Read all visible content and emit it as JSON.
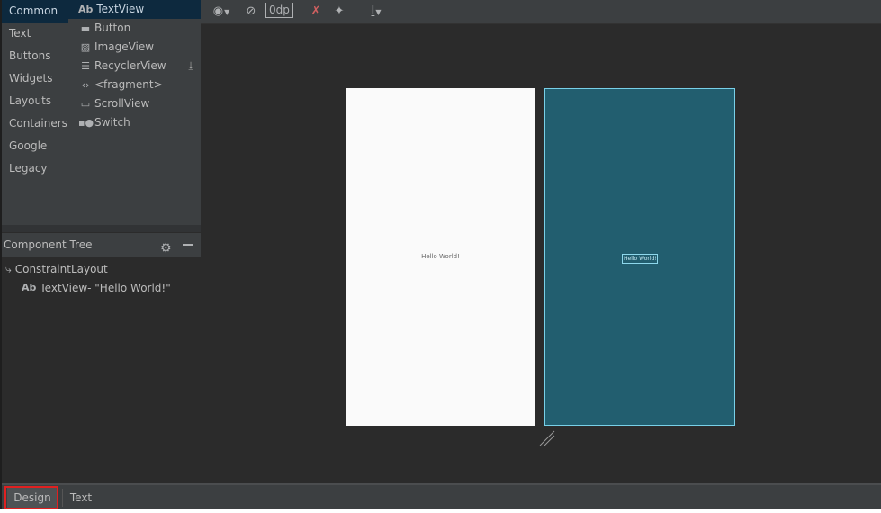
{
  "palette": {
    "categories": [
      {
        "label": "Common",
        "selected": true
      },
      {
        "label": "Text",
        "selected": false
      },
      {
        "label": "Buttons",
        "selected": false
      },
      {
        "label": "Widgets",
        "selected": false
      },
      {
        "label": "Layouts",
        "selected": false
      },
      {
        "label": "Containers",
        "selected": false
      },
      {
        "label": "Google",
        "selected": false
      },
      {
        "label": "Legacy",
        "selected": false
      }
    ],
    "widgets": [
      {
        "label": "TextView",
        "icon": "Ab",
        "icon_name": "textview-icon",
        "selected": true
      },
      {
        "label": "Button",
        "icon": "▬",
        "icon_name": "button-icon",
        "selected": false
      },
      {
        "label": "ImageView",
        "icon": "▨",
        "icon_name": "imageview-icon",
        "selected": false
      },
      {
        "label": "RecyclerView",
        "icon": "☰",
        "icon_name": "recyclerview-icon",
        "selected": false
      },
      {
        "label": "<fragment>",
        "icon": "‹›",
        "icon_name": "fragment-icon",
        "selected": false
      },
      {
        "label": "ScrollView",
        "icon": "▭",
        "icon_name": "scrollview-icon",
        "selected": false
      },
      {
        "label": "Switch",
        "icon": "▪●",
        "icon_name": "switch-icon",
        "selected": false
      }
    ],
    "download_icon": "⤓"
  },
  "component_tree": {
    "title": "Component Tree",
    "root": {
      "label": "ConstraintLayout",
      "icon": "⤷"
    },
    "child": {
      "icon": "Ab",
      "label": "TextView",
      "suffix": "- \"Hello World!\""
    }
  },
  "toolbar": {
    "eye_icon": "◉",
    "magnet_icon": "⊘",
    "margin_value": "0dp",
    "clear_constraints_icon": "✗",
    "infer_constraints_icon": "✦",
    "align_icon": "I",
    "caret": "▼"
  },
  "canvas": {
    "design_text": "Hello World!",
    "blueprint_text": "Hello World!",
    "design_background": "#fafafa",
    "blueprint_background": "#225e6f"
  },
  "bottom_tabs": [
    {
      "label": "Design",
      "selected": true
    },
    {
      "label": "Text",
      "selected": false
    }
  ],
  "colors": {
    "selection": "#0d293e",
    "highlight": "#e02020"
  }
}
